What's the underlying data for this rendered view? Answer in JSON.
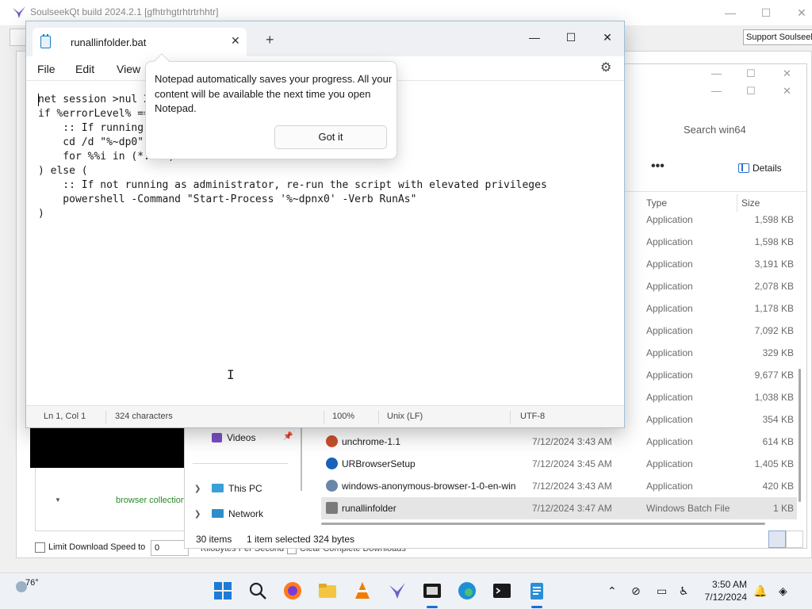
{
  "soulseek": {
    "title": "SoulseekQt build 2024.2.1 [gfhtrhgtrhtrtrhhtr]",
    "support_label": "Support Soulseek",
    "tree_label": "browser collection",
    "limit_label": "Limit Download Speed to",
    "limit_value": "0",
    "kbps_label": "Kilobytes Per Second",
    "clear_label": "Clear Complete Downloads",
    "colors": {
      "tree_label": "#2a8a2a"
    }
  },
  "explorer": {
    "search_placeholder": "Search win64",
    "details_label": "Details",
    "more_label": "•••",
    "columns": {
      "type": "Type",
      "size": "Size"
    },
    "rows": [
      {
        "name": "",
        "date": "",
        "type": "Application",
        "size": "1,598 KB",
        "icon": "app-icon"
      },
      {
        "name": "",
        "date": "",
        "type": "Application",
        "size": "1,598 KB",
        "icon": "app-icon"
      },
      {
        "name": "",
        "date": "",
        "type": "Application",
        "size": "3,191 KB",
        "icon": "app-icon"
      },
      {
        "name": "",
        "date": "",
        "type": "Application",
        "size": "2,078 KB",
        "icon": "app-icon"
      },
      {
        "name": "",
        "date": "",
        "type": "Application",
        "size": "1,178 KB",
        "icon": "app-icon"
      },
      {
        "name": "",
        "date": "",
        "type": "Application",
        "size": "7,092 KB",
        "icon": "app-icon"
      },
      {
        "name": "",
        "date": "",
        "type": "Application",
        "size": "329 KB",
        "icon": "app-icon"
      },
      {
        "name": "",
        "date": "",
        "type": "Application",
        "size": "9,677 KB",
        "icon": "app-icon"
      },
      {
        "name": "",
        "date": "",
        "type": "Application",
        "size": "1,038 KB",
        "icon": "app-icon"
      },
      {
        "name": "",
        "date": "",
        "type": "Application",
        "size": "354 KB",
        "icon": "app-icon"
      },
      {
        "name": "unchrome-1.1",
        "date": "7/12/2024 3:43 AM",
        "type": "Application",
        "size": "614 KB",
        "icon": "unchrome-icon"
      },
      {
        "name": "URBrowserSetup",
        "date": "7/12/2024 3:45 AM",
        "type": "Application",
        "size": "1,405 KB",
        "icon": "urbrowser-icon"
      },
      {
        "name": "windows-anonymous-browser-1-0-en-win",
        "date": "7/12/2024 3:43 AM",
        "type": "Application",
        "size": "420 KB",
        "icon": "installer-icon"
      },
      {
        "name": "runallinfolder",
        "date": "7/12/2024 3:47 AM",
        "type": "Windows Batch File",
        "size": "1 KB",
        "icon": "batch-file-icon",
        "selected": true
      }
    ],
    "nav": {
      "videos": "Videos",
      "this_pc": "This PC",
      "network": "Network"
    },
    "status": {
      "items": "30 items",
      "selected": "1 item selected",
      "bytes": "324 bytes"
    }
  },
  "notepad": {
    "tab_title": "runallinfolder.bat",
    "menu": {
      "file": "File",
      "edit": "Edit",
      "view": "View"
    },
    "code": "net session >nul 2>&1\nif %errorLevel% == 0 (\n    :: If running as administrator, run the script\n    cd /d \"%~dp0\"\n    for %%i in (*.exe) do start \"\" \"%%i\"\n) else (\n    :: If not running as administrator, re-run the script with elevated privileges\n    powershell -Command \"Start-Process '%~dpnx0' -Verb RunAs\"\n)",
    "status": {
      "position": "Ln 1, Col 1",
      "characters": "324 characters",
      "zoom": "100%",
      "line_ending": "Unix (LF)",
      "encoding": "UTF-8"
    }
  },
  "teaching_tip": {
    "message": "Notepad automatically saves your progress. All your content will be available the next time you open Notepad.",
    "button": "Got it"
  },
  "taskbar": {
    "weather": "76°",
    "time": "3:50 AM",
    "date": "7/12/2024",
    "apps": [
      "windows-start-icon",
      "search-icon",
      "firefox-icon",
      "file-explorer-icon",
      "vlc-icon",
      "soulseek-icon",
      "media-icon",
      "edge-icon",
      "terminal-icon",
      "notepad-icon"
    ]
  }
}
